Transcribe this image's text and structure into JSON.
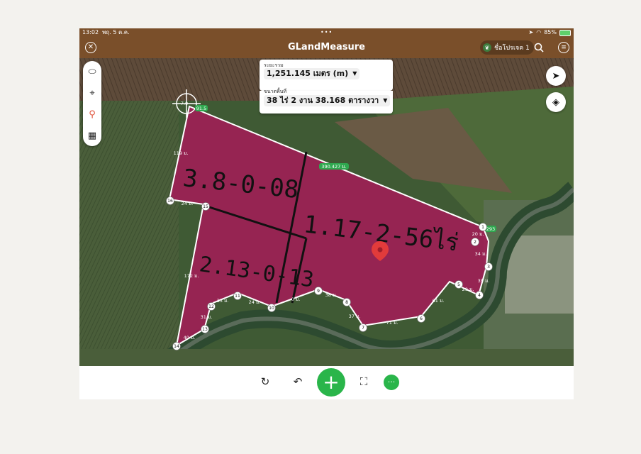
{
  "status_bar": {
    "time": "13:02",
    "date": "พฤ. 5 ต.ค.",
    "multitask_dots": "•••",
    "battery": "85%"
  },
  "nav": {
    "title": "GLandMeasure",
    "project_chip": "ชื่อโปรเจค 1",
    "icons": [
      "close-icon",
      "leaf-icon",
      "search-icon",
      "menu-icon"
    ]
  },
  "info_panel": {
    "distance_label": "ระยะรวม",
    "distance_value": "1,251.145 เมตร (m)",
    "area_label": "ขนาดพื้นที่",
    "area_value": "38 ไร่ 2 งาน 38.168 ตารางวา"
  },
  "map": {
    "polygon_color": "#a01e55",
    "handwritten": {
      "plot3": "3.8-0-08",
      "plot1": "1.17-2-56ไร่",
      "plot2": "2.13-0-13"
    },
    "vertex_labels": [
      "1",
      "2",
      "3",
      "4",
      "5",
      "6",
      "7",
      "8",
      "9",
      "10",
      "11",
      "12",
      "13",
      "14",
      "15",
      "16"
    ],
    "edge_labels": {
      "top": "390.427 ม.",
      "top_left": "7.0",
      "top_left_green": "91.5",
      "left_upper": "119 ม.",
      "e16_15": "24 ม.",
      "left_lower": "172 ม.",
      "e14_13": "40 ม.",
      "e13_12": "31 ม.",
      "e12_11": "33 ม.",
      "e11_10": "24 ม.",
      "e10_9": "0 ม.",
      "e9_8": "38 ม.",
      "e8_7": "37 ม.",
      "e7_6": "71 ม.",
      "e6_5": "61 ม.",
      "e5_4": "29 ม.",
      "e4_3": "35 ม.",
      "e3_2": "34 ม.",
      "e2_1": "20 ม.",
      "e1_green": "293"
    }
  },
  "bottom_bar": {
    "icons": [
      "refresh-icon",
      "undo-icon",
      "add-icon",
      "focus-icon",
      "more-icon"
    ],
    "add_symbol": "+",
    "more_symbol": "···"
  }
}
